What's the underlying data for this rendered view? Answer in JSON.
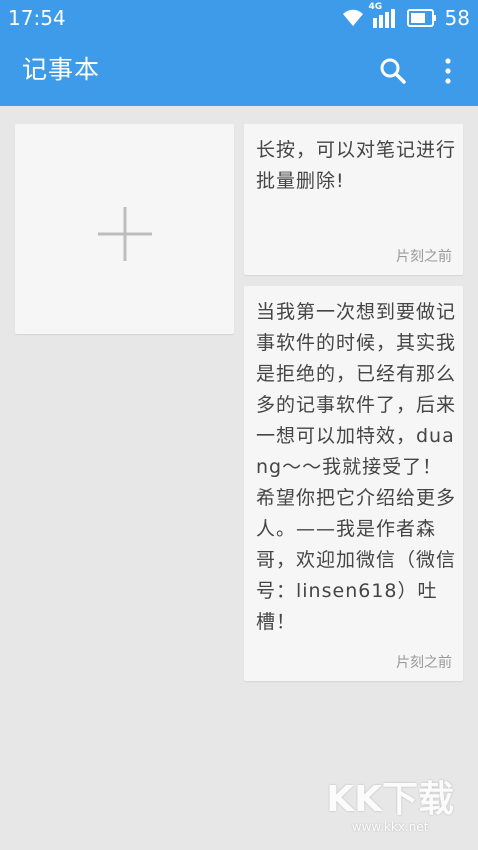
{
  "status_bar": {
    "time": "17:54",
    "network_label": "4G",
    "battery": "58",
    "icons": [
      "wifi-icon",
      "signal-icon",
      "battery-icon"
    ]
  },
  "toolbar": {
    "title": "记事本",
    "icons": [
      "search-icon",
      "more-vert-icon"
    ]
  },
  "add_card": {
    "icon": "plus-icon"
  },
  "notes": [
    {
      "text": "长按，可以对笔记进行批量删除!",
      "time": "片刻之前"
    },
    {
      "text": "当我第一次想到要做记事软件的时候，其实我是拒绝的，已经有那么多的记事软件了，后来一想可以加特效，duang～～我就接受了！希望你把它介绍给更多人。——我是作者森哥，欢迎加微信（微信号：linsen618）吐槽！",
      "time": "片刻之前"
    }
  ],
  "watermark": {
    "logo": "KK下载",
    "url": "www.kkx.net"
  },
  "colors": {
    "header": "#3d9bea",
    "background": "#e7e7e7",
    "card": "#f6f6f6",
    "text": "#454545",
    "muted": "#9a9a9a"
  }
}
